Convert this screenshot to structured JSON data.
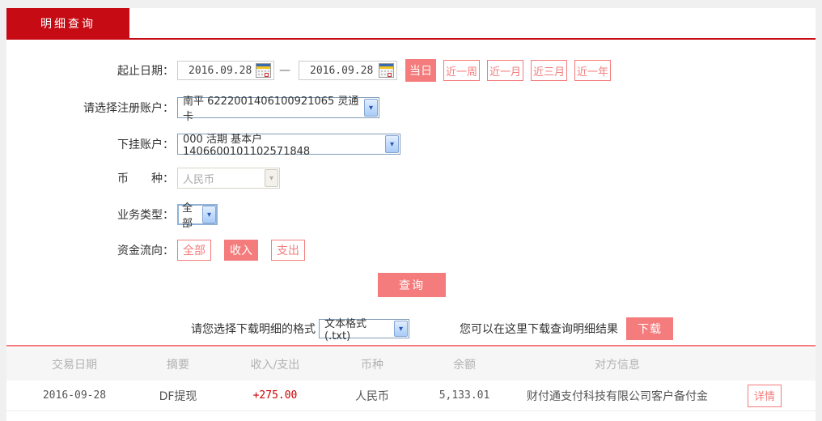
{
  "colors": {
    "accent_red": "#c60b14",
    "salmon": "#f47c7c",
    "amount_red": "#cc0000"
  },
  "tab": {
    "label": "明细查询"
  },
  "form": {
    "date_range": {
      "label": "起止日期：",
      "start": "2016.09.28",
      "end": "2016.09.28",
      "separator": "—",
      "quick_buttons": [
        {
          "label": "当日",
          "active": true
        },
        {
          "label": "近一周",
          "active": false
        },
        {
          "label": "近一月",
          "active": false
        },
        {
          "label": "近三月",
          "active": false
        },
        {
          "label": "近一年",
          "active": false
        }
      ]
    },
    "register_account": {
      "label": "请选择注册账户：",
      "value": "南平 6222001406100921065 灵通卡"
    },
    "sub_account": {
      "label": "下挂账户：",
      "value": "000 活期 基本户 1406600101102571848"
    },
    "currency": {
      "label": "币　　种：",
      "value": "人民币",
      "disabled": true
    },
    "business_type": {
      "label": "业务类型：",
      "value": "全部"
    },
    "fund_flow": {
      "label": "资金流向：",
      "options": [
        {
          "label": "全部",
          "active": false
        },
        {
          "label": "收入",
          "active": true
        },
        {
          "label": "支出",
          "active": false
        }
      ]
    },
    "query_button": "查询"
  },
  "download": {
    "format_label": "请您选择下载明细的格式",
    "format_value": "文本格式 (.txt)",
    "hint": "您可以在这里下载查询明细结果",
    "button": "下载"
  },
  "table": {
    "headers": [
      "交易日期",
      "摘要",
      "收入/支出",
      "币种",
      "余额",
      "对方信息"
    ],
    "rows": [
      {
        "date": "2016-09-28",
        "summary": "DF提现",
        "amount": "+275.00",
        "currency": "人民币",
        "balance": "5,133.01",
        "counterparty": "财付通支付科技有限公司客户备付金",
        "detail_button": "详情"
      }
    ]
  }
}
